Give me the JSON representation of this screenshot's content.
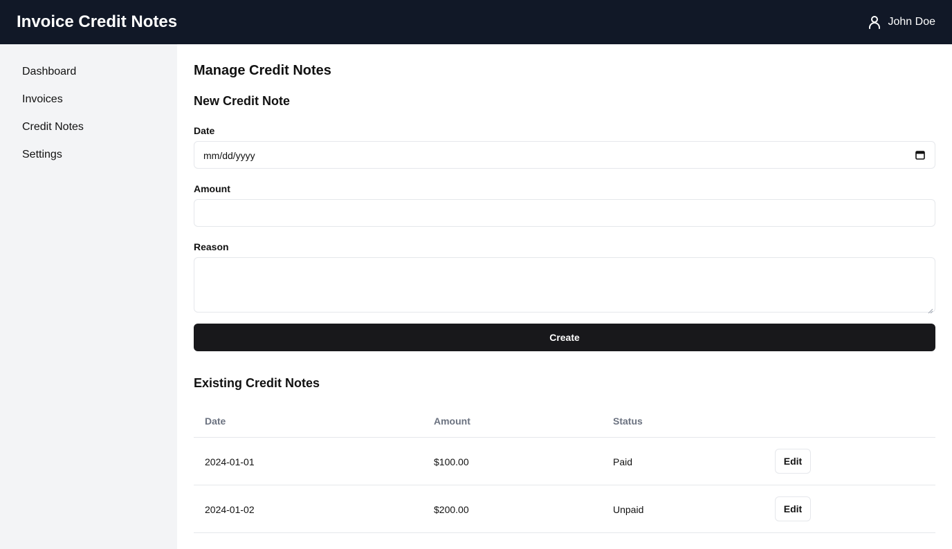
{
  "app": {
    "title": "Invoice Credit Notes"
  },
  "user": {
    "name": "John Doe",
    "icon": "user-icon"
  },
  "sidebar": {
    "items": [
      {
        "label": "Dashboard"
      },
      {
        "label": "Invoices"
      },
      {
        "label": "Credit Notes"
      },
      {
        "label": "Settings"
      }
    ]
  },
  "page": {
    "title": "Manage Credit Notes"
  },
  "form": {
    "title": "New Credit Note",
    "date": {
      "label": "Date",
      "placeholder": "mm/dd/yyyy",
      "icon": "calendar-icon"
    },
    "amount": {
      "label": "Amount",
      "value": ""
    },
    "reason": {
      "label": "Reason",
      "value": ""
    },
    "submit_label": "Create"
  },
  "table": {
    "title": "Existing Credit Notes",
    "columns": [
      "Date",
      "Amount",
      "Status"
    ],
    "rows": [
      {
        "date": "2024-01-01",
        "amount": "$100.00",
        "status": "Paid",
        "action": "Edit"
      },
      {
        "date": "2024-01-02",
        "amount": "$200.00",
        "status": "Unpaid",
        "action": "Edit"
      }
    ]
  },
  "colors": {
    "topbar": "#111827",
    "sidebar": "#f3f4f6",
    "primary_button": "#18181b",
    "border": "#e5e7eb",
    "muted_text": "#6b7280"
  }
}
